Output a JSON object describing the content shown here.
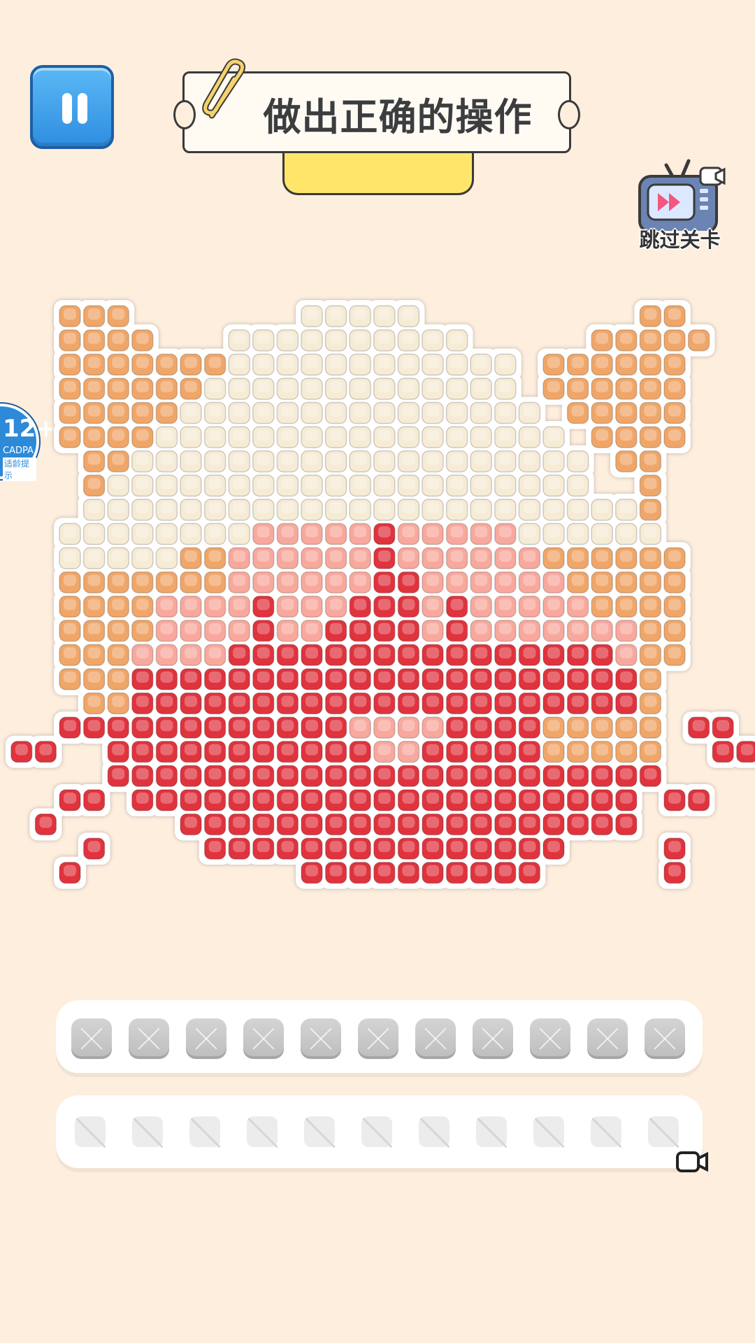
{
  "header": {
    "title": "做出正确的操作",
    "skip_label": "跳过关卡"
  },
  "age_badge": {
    "rating": "12+",
    "org": "CADPA",
    "note": "适龄提示"
  },
  "colors": {
    "background": "#fdeede",
    "orange": "#f0a668",
    "cream": "#f6ecd6",
    "pink": "#f8a89c",
    "red": "#e0333d",
    "progress_fill": "#ffe66b"
  },
  "icons": {
    "pause": "pause-icon",
    "clip": "paperclip-icon",
    "skip": "tv-fast-forward-icon",
    "video": "video-camera-icon"
  },
  "board": {
    "rows": [
      "OOO.......CCCCC.........OO..",
      "OOOO...CCCCCCCCCC.....OOOOO.",
      "OOOOOOOCCCCCCCCCCCC.OOOOOO..",
      "OOOOOOCCCCCCCCCCCCC.OOOOOO..",
      "OOOOOCCCCCCCCCCCCCCC.OOOOO..",
      "OOOOCCCCCCCCCCCCCCCCC.OOOO..",
      ".OOCCCCCCCCCCCCCCCCCCC.OO...",
      ".OCCCCCCCCCCCCCCCCCCCC..O...",
      ".CCCCCCCCCCCCCCCCCCCCCCCO...",
      "CCCCCCCCPPPPPRPPPPPCCCCCC...",
      "CCCCCOOPPPPPPRPPPPPPOOOOOO..",
      "OOOOOOOPPPPPPRRPPPPPPOOOOO..",
      "OOOOPPPPRPPPRRRPRPPPPPOOOO..",
      "OOOOPPPPRPPRRRRPRPPPPPPPOO..",
      "OOOPPPPRRRRRRRRRRRRRRRRPOO..",
      "OOORRRRRRRRRRRRRRRRRRRRRO...",
      ".OORRRRRRRRRRRRRRRRRRRRRO...",
      "RRRRRRRRRRRRPPPPRRRROOOOO.RR",
      "..RRRRRRRRRRRPPRRRRROOOOO..R",
      "..RRRRRRRRRRRRRRRRRRRRRRR...",
      "RR.RRRRRRRRRRRRRRRRRRRRR.RR.",
      ".....RRRRRRRRRRRRRRRRRRR....",
      "......RRRRRRRRRRRRRRR....R..",
      "..........RRRRRRRRRR.....R.."
    ],
    "extras": [
      {
        "row": 18,
        "col": -2,
        "color": "R"
      },
      {
        "row": 18,
        "col": -1,
        "color": "R"
      },
      {
        "row": 18,
        "col": 28,
        "color": "R"
      },
      {
        "row": 21,
        "col": -1,
        "color": "R"
      },
      {
        "row": 22,
        "col": 1,
        "color": "R"
      },
      {
        "row": 23,
        "col": 0,
        "color": "R"
      }
    ]
  },
  "tray_slots": 11,
  "locked_slots": 11
}
